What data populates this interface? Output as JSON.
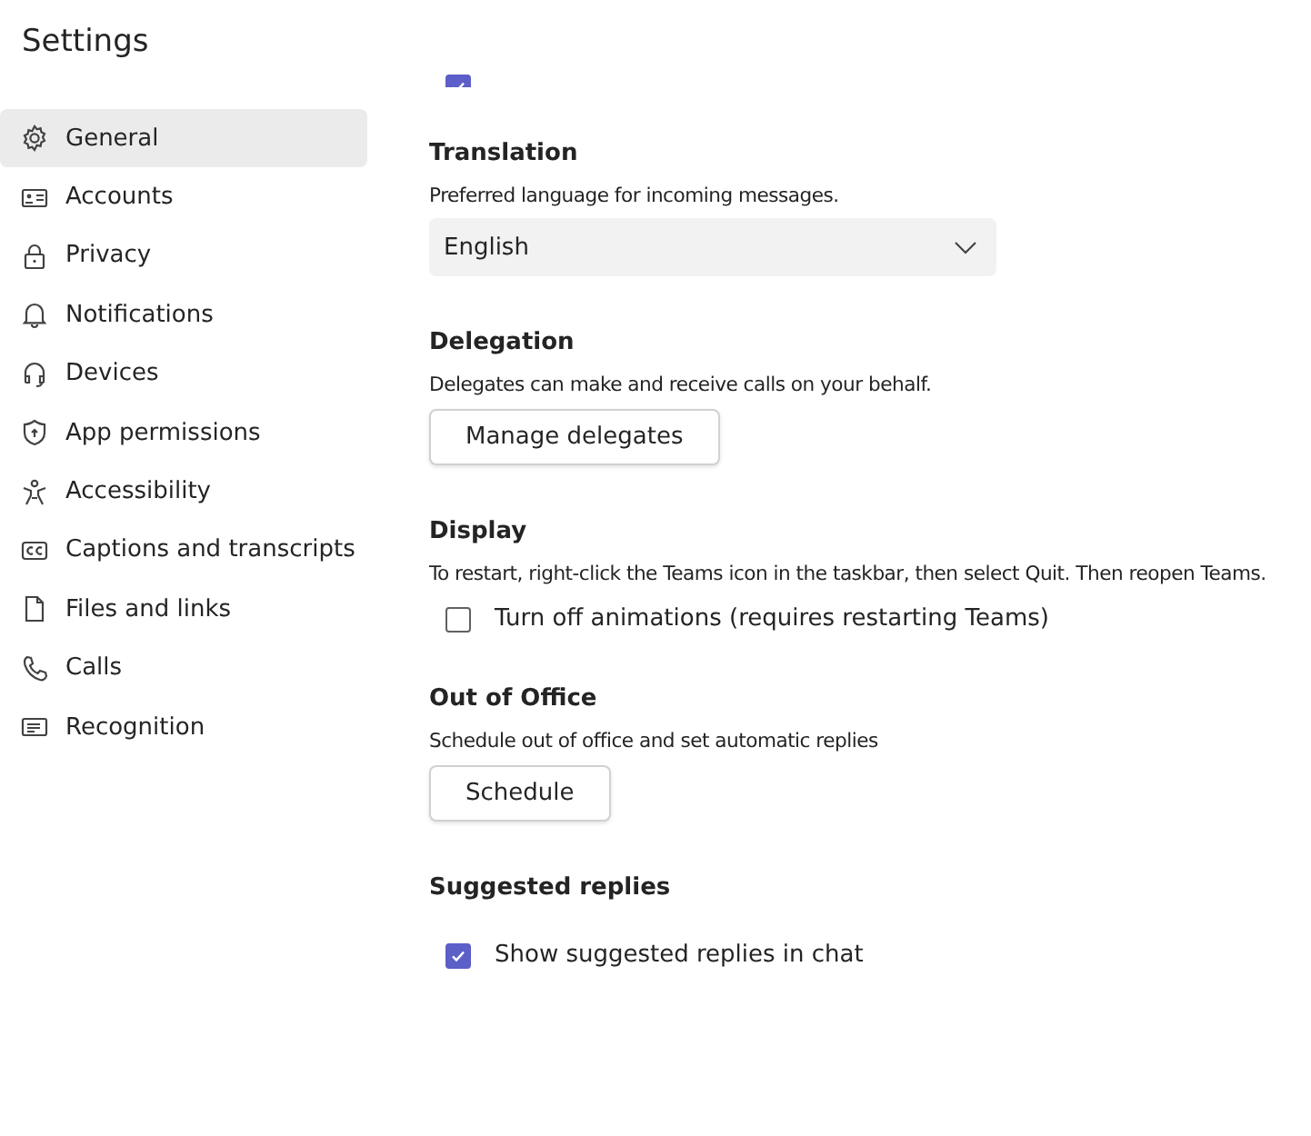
{
  "title": "Settings",
  "sidebar": {
    "items": [
      {
        "label": "General",
        "selected": true
      },
      {
        "label": "Accounts",
        "selected": false
      },
      {
        "label": "Privacy",
        "selected": false
      },
      {
        "label": "Notifications",
        "selected": false
      },
      {
        "label": "Devices",
        "selected": false
      },
      {
        "label": "App permissions",
        "selected": false
      },
      {
        "label": "Accessibility",
        "selected": false
      },
      {
        "label": "Captions and transcripts",
        "selected": false
      },
      {
        "label": "Files and links",
        "selected": false
      },
      {
        "label": "Calls",
        "selected": false
      },
      {
        "label": "Recognition",
        "selected": false
      }
    ]
  },
  "top_row": {
    "checked": true
  },
  "sections": [
    {
      "heading": "Translation",
      "description": "Preferred language for incoming messages.",
      "controls": [
        {
          "kind": "dropdown",
          "value": "English"
        }
      ]
    },
    {
      "heading": "Delegation",
      "description": "Delegates can make and receive calls on your behalf.",
      "controls": [
        {
          "kind": "button",
          "label": "Manage delegates"
        }
      ]
    },
    {
      "heading": "Display",
      "description": "To restart, right-click the Teams icon in the taskbar, then select Quit. Then reopen Teams.",
      "controls": [
        {
          "kind": "checkbox",
          "label": "Turn off animations (requires restarting Teams)",
          "checked": false
        }
      ]
    },
    {
      "heading": "Out of Office",
      "description": "Schedule out of office and set automatic replies",
      "controls": [
        {
          "kind": "button",
          "label": "Schedule"
        }
      ]
    },
    {
      "heading": "Suggested replies",
      "controls": [
        {
          "kind": "checkbox",
          "label": "Show suggested replies in chat",
          "checked": true
        }
      ]
    }
  ]
}
